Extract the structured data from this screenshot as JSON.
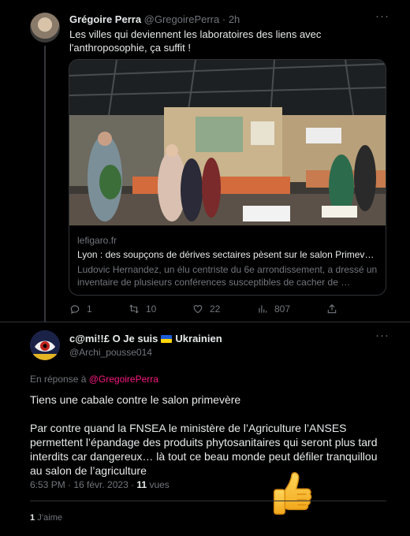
{
  "tweet1": {
    "name": "Grégoire Perra",
    "handle": "@GregoirePerra",
    "time": "· 2h",
    "text": "Les villes qui deviennent les laboratoires des liens avec l'anthroposophie, ça suffit !",
    "card": {
      "domain": "lefigaro.fr",
      "title": "Lyon : des soupçons de dérives sectaires pèsent sur le salon Primev…",
      "description": "Ludovic Hernandez, un élu centriste du 6e arrondissement, a dressé un inventaire de plusieurs conférences susceptibles de cacher de …"
    },
    "actions": {
      "replies": "1",
      "retweets": "10",
      "likes": "22",
      "views": "807"
    }
  },
  "tweet2": {
    "name": "c@mi!!£ O Je suis",
    "name_suffix": "Ukrainien",
    "handle": "@Archi_pousse014",
    "reply_prefix": "En réponse à",
    "reply_to": "@GregoirePerra",
    "paragraph1": "Tiens une cabale contre le salon primevère",
    "paragraph2": "Par contre quand la FNSEA le ministère de l’Agriculture l’ANSES permettent l’épandage des produits phytosanitaires qui seront plus tard interdits car dangereux… là tout ce beau monde peut défiler tranquillou au salon de l’agriculture",
    "timestamp": "6:53 PM · 16 févr. 2023 ·",
    "views_count": "11",
    "views_label": "vues",
    "likes_count": "1",
    "likes_label": "J’aime"
  },
  "icons": [
    "more-icon",
    "reply-icon",
    "retweet-icon",
    "like-icon",
    "views-icon",
    "share-icon",
    "ukraine-flag-icon",
    "thumbs-up-emoji"
  ]
}
